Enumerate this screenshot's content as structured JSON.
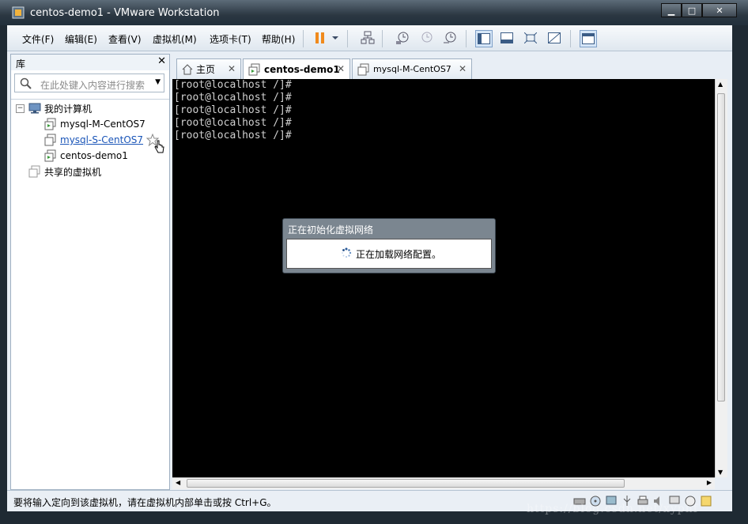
{
  "window": {
    "title": "centos-demo1 - VMware Workstation"
  },
  "menu": [
    {
      "label": "文件(F)",
      "name": "menu-file"
    },
    {
      "label": "编辑(E)",
      "name": "menu-edit"
    },
    {
      "label": "查看(V)",
      "name": "menu-view"
    },
    {
      "label": "虚拟机(M)",
      "name": "menu-vm"
    },
    {
      "label": "选项卡(T)",
      "name": "menu-tabs"
    },
    {
      "label": "帮助(H)",
      "name": "menu-help"
    }
  ],
  "library": {
    "title": "库",
    "close": "✕",
    "search_placeholder": "在此处键入内容进行搜索",
    "tree": {
      "my_computer": "我的计算机",
      "vms": [
        "mysql-M-CentOS7",
        "mysql-S-CentOS7",
        "centos-demo1"
      ],
      "shared": "共享的虚拟机"
    }
  },
  "tabs": [
    {
      "label": "主页"
    },
    {
      "label": "centos-demo1"
    },
    {
      "label": "mysql-M-CentOS7"
    }
  ],
  "terminal": {
    "lines": [
      "[root@localhost /]#",
      "[root@localhost /]#",
      "[root@localhost /]#",
      "[root@localhost /]#",
      "[root@localhost /]#"
    ]
  },
  "dialog": {
    "title": "正在初始化虚拟网络",
    "message": "正在加载网络配置。"
  },
  "status": {
    "text": "要将输入定向到该虚拟机，请在虚拟机内部单击或按 Ctrl+G。"
  },
  "watermark": "https://blog.csdn.net/xyphf",
  "colors": {
    "accent": "#1a55b8",
    "pause": "#f08a1c",
    "console": "#000000"
  }
}
